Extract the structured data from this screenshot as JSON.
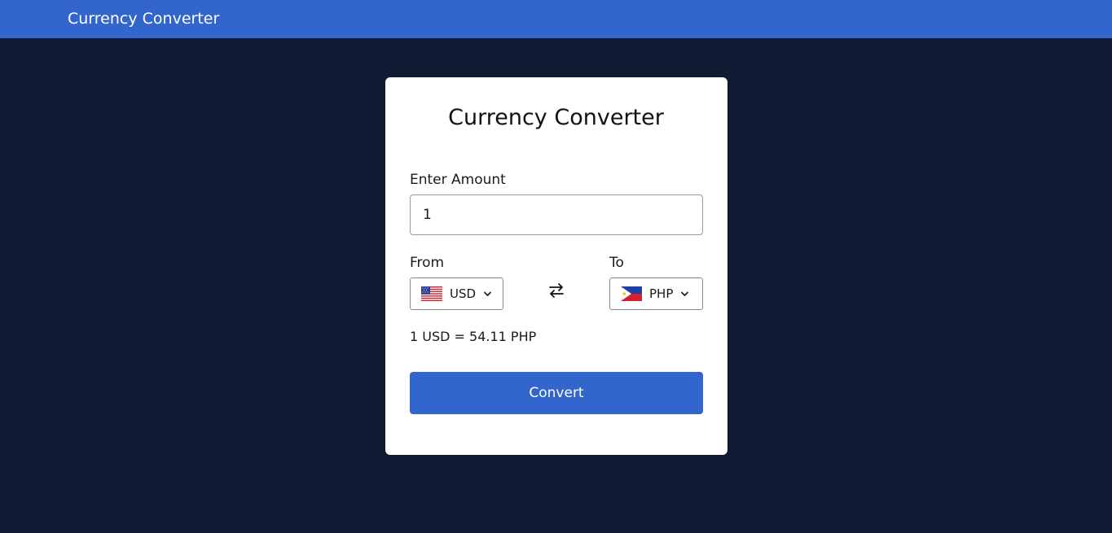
{
  "navbar": {
    "brand": "Currency Converter"
  },
  "card": {
    "title": "Currency Converter",
    "amount_label": "Enter Amount",
    "amount_value": "1",
    "from_label": "From",
    "from_currency": "USD",
    "from_flag_icon": "us-flag-icon",
    "to_label": "To",
    "to_currency": "PHP",
    "to_flag_icon": "ph-flag-icon",
    "swap_icon": "swap-arrows-icon",
    "rate_text": "1 USD = 54.11 PHP",
    "convert_label": "Convert"
  },
  "colors": {
    "navbar_bg": "#3366cc",
    "page_bg": "#0f1b33",
    "card_bg": "#ffffff",
    "button_bg": "#3366cc"
  }
}
